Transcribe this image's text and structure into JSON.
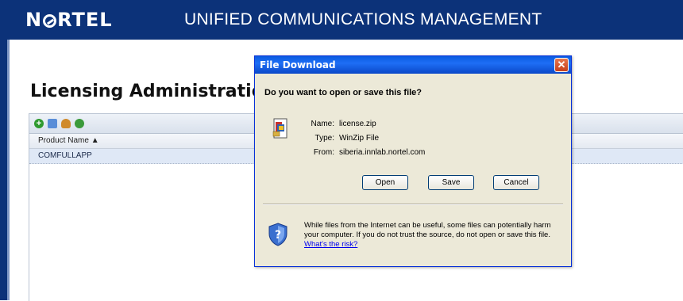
{
  "header": {
    "logo_prefix": "N",
    "logo_suffix": "RTEL",
    "title": "UNIFIED COMMUNICATIONS MANAGEMENT",
    "background": "#0c3279"
  },
  "page": {
    "title": "Licensing Administration"
  },
  "grid": {
    "toolbar_icons": [
      "add-icon",
      "edit-icon",
      "user-icon",
      "refresh-icon"
    ],
    "column_header": "Product Name ▲",
    "rows": [
      "COMFULLAPP"
    ]
  },
  "dialog": {
    "title": "File Download",
    "question": "Do you want to open or save this file?",
    "name_label": "Name:",
    "name_value": "license.zip",
    "type_label": "Type:",
    "type_value": "WinZip File",
    "from_label": "From:",
    "from_value": "siberia.innlab.nortel.com",
    "open_label": "Open",
    "save_label": "Save",
    "cancel_label": "Cancel",
    "warning_text": "While files from the Internet can be useful, some files can potentially harm your computer. If you do not trust the source, do not open or save this file.",
    "risk_link": "What's the risk?",
    "close_glyph": "✕"
  }
}
